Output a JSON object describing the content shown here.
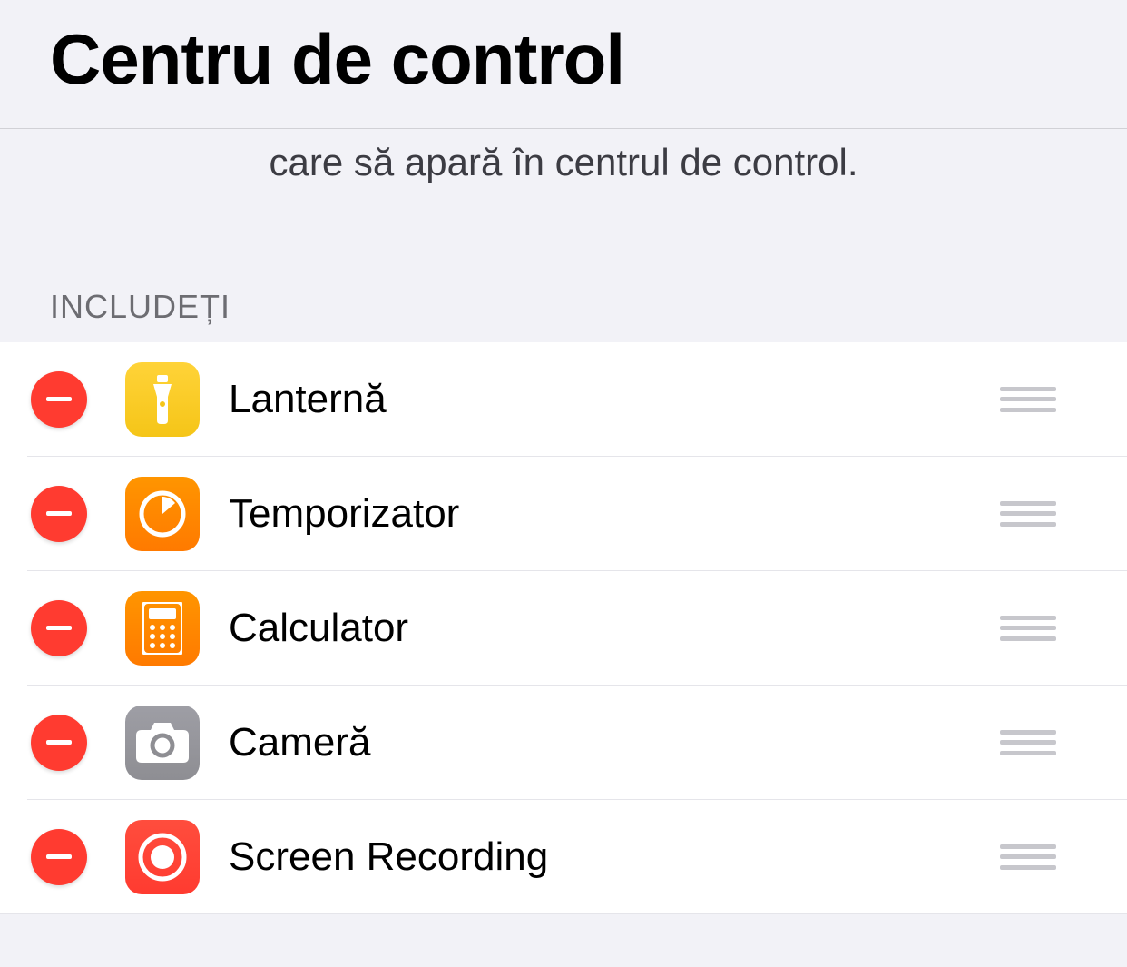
{
  "header": {
    "title": "Centru de control"
  },
  "description": "care să apară în centrul de control.",
  "section": {
    "include_label": "INCLUDEȚI"
  },
  "items": [
    {
      "label": "Lanternă",
      "icon": "flashlight"
    },
    {
      "label": "Temporizator",
      "icon": "timer"
    },
    {
      "label": "Calculator",
      "icon": "calculator"
    },
    {
      "label": "Cameră",
      "icon": "camera"
    },
    {
      "label": "Screen Recording",
      "icon": "recording"
    }
  ]
}
